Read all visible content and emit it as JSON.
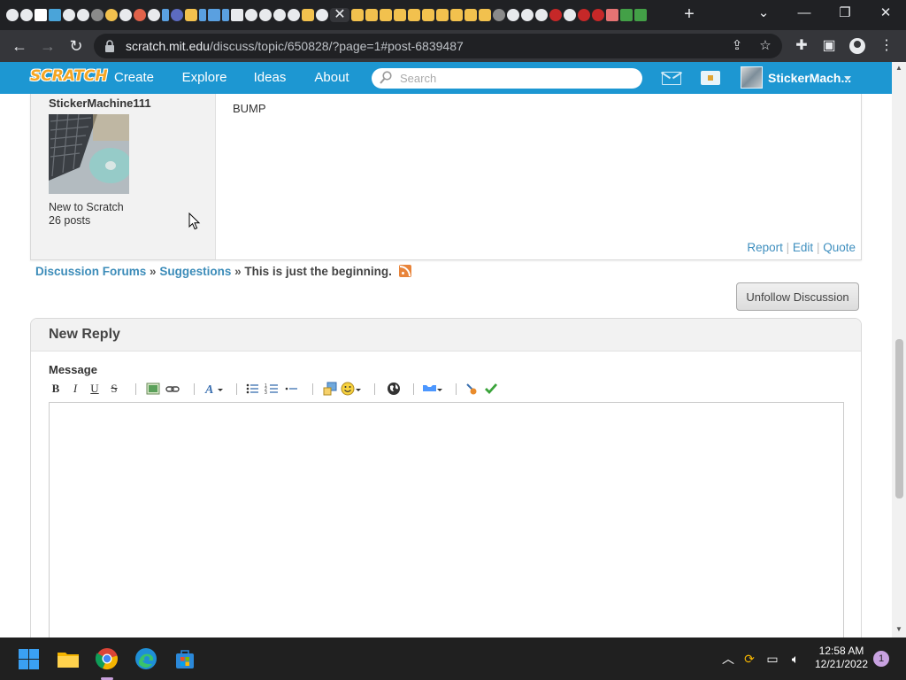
{
  "browser": {
    "tab_close_glyph": "✕",
    "new_tab_glyph": "+",
    "window_controls": {
      "dropdown": "⌄",
      "minimize": "—",
      "restore": "❐",
      "close": "✕"
    },
    "nav": {
      "back": "←",
      "forward": "→",
      "reload": "↻"
    },
    "url_host": "scratch.mit.edu",
    "url_path": "/discuss/topic/650828/?page=1#post-6839487",
    "toolbar_icons": [
      "share-icon",
      "star-icon",
      "extensions-icon",
      "sidebar-icon",
      "profile-icon",
      "menu-icon"
    ]
  },
  "scratch_header": {
    "logo_text": "SCRATCH",
    "nav": {
      "create": "Create",
      "explore": "Explore",
      "ideas": "Ideas",
      "about": "About"
    },
    "search_placeholder": "Search",
    "username": "StickerMach..."
  },
  "post": {
    "author": "StickerMachine111",
    "rank": "New to Scratch",
    "post_count": "26 posts",
    "body": "BUMP",
    "actions": {
      "report": "Report",
      "edit": "Edit",
      "quote": "Quote",
      "separator": "|"
    }
  },
  "breadcrumb": {
    "forums": "Discussion Forums",
    "sep": "»",
    "category": "Suggestions",
    "topic": "This is just the beginning."
  },
  "unfollow_button": "Unfollow Discussion",
  "reply": {
    "title": "New Reply",
    "message_label": "Message",
    "toolbar": [
      "bold",
      "italic",
      "underline",
      "strikethrough",
      "image",
      "link",
      "font-color",
      "bulleted-list",
      "numbered-list",
      "list-item",
      "code",
      "smiley",
      "preview",
      "scratchblocks",
      "clean",
      "check"
    ],
    "toolbar_labels": {
      "bold": "B",
      "italic": "I",
      "underline": "U",
      "strike": "S"
    },
    "message_value": ""
  },
  "taskbar": {
    "time": "12:58 AM",
    "date": "12/21/2022",
    "notifications": "1"
  },
  "colors": {
    "scratch_blue": "#1d97d2",
    "link_blue": "#3c8cb9",
    "chrome_dark": "#202124",
    "chrome_toolbar": "#35363a"
  }
}
